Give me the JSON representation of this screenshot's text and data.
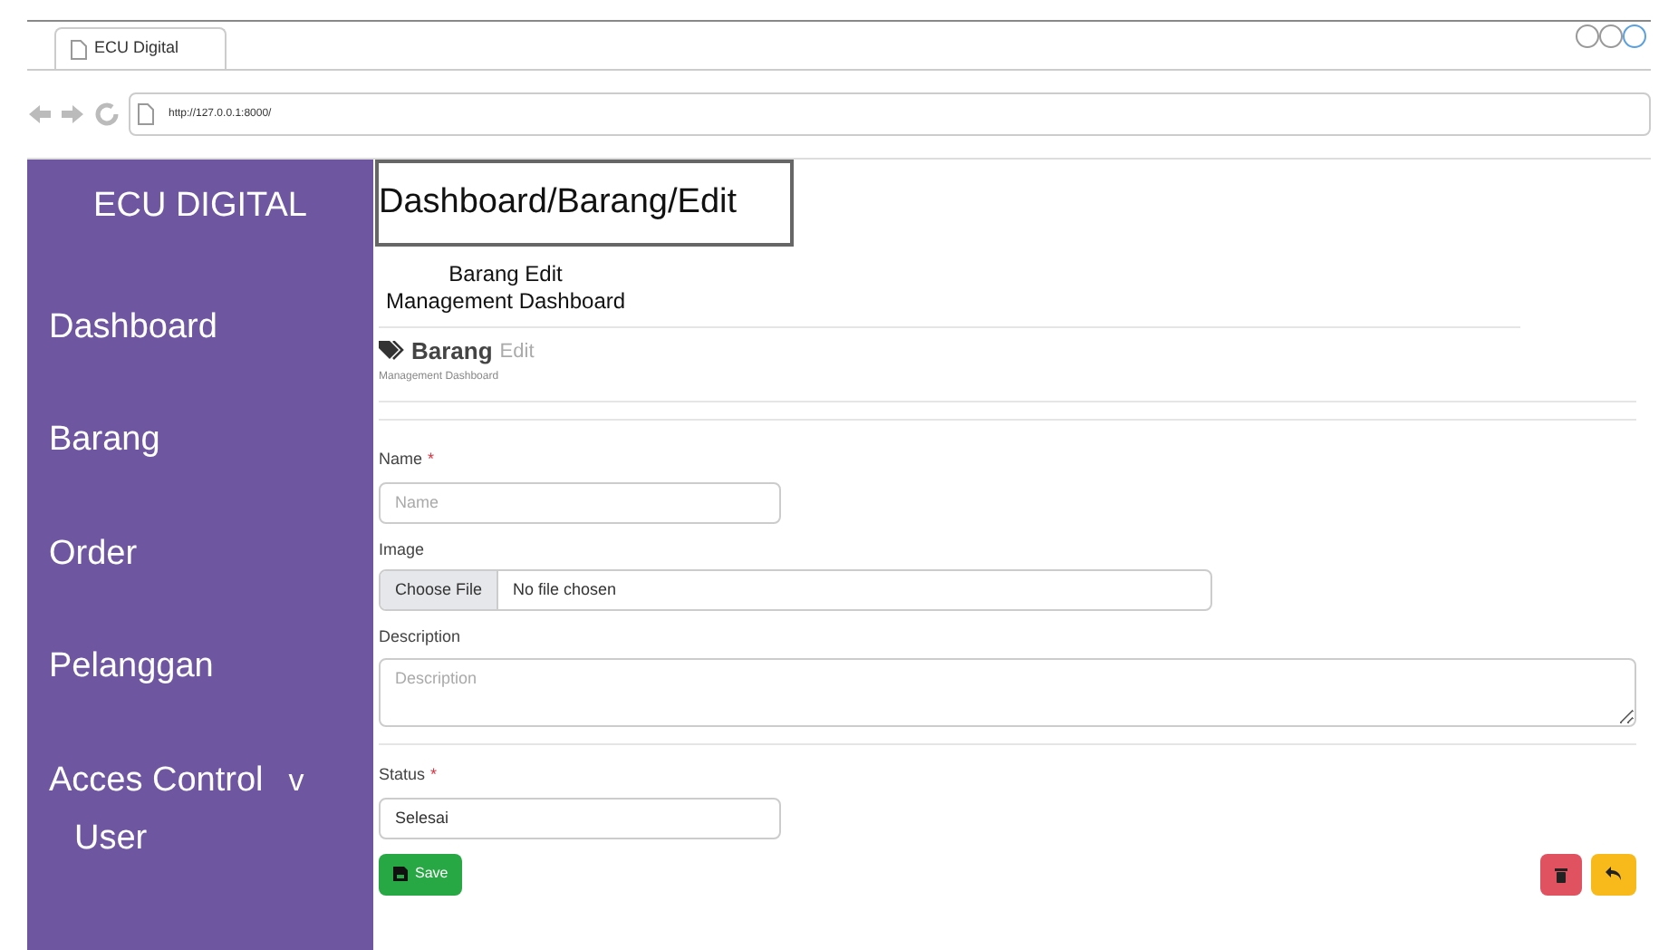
{
  "browser": {
    "tab_title": "ECU Digital",
    "url": "http://127.0.0.1:8000/"
  },
  "sidebar": {
    "title": "ECU DIGITAL",
    "items": [
      {
        "label": "Dashboard"
      },
      {
        "label": "Barang"
      },
      {
        "label": "Order"
      },
      {
        "label": "Pelanggan"
      },
      {
        "label": "Acces Control",
        "toggle": "v",
        "expanded": true,
        "children": [
          {
            "label": "User"
          }
        ]
      }
    ]
  },
  "breadcrumb": "Dashboard/Barang/Edit",
  "page_header": {
    "title": "Barang Edit",
    "subtitle": "Management Dashboard"
  },
  "card_header": {
    "title": "Barang",
    "title_suffix": "Edit",
    "subtitle": "Management Dashboard"
  },
  "form": {
    "fields": [
      {
        "kind": "text",
        "label": "Name",
        "required_mark": "*",
        "placeholder": "Name"
      },
      {
        "kind": "file",
        "label": "Image",
        "button": "Choose File",
        "value": "No file chosen"
      },
      {
        "kind": "textarea",
        "label": "Description",
        "placeholder": "Description"
      },
      {
        "kind": "text",
        "label": "Status",
        "required_mark": "*",
        "value": "Selesai"
      }
    ],
    "save_button": "Save"
  }
}
